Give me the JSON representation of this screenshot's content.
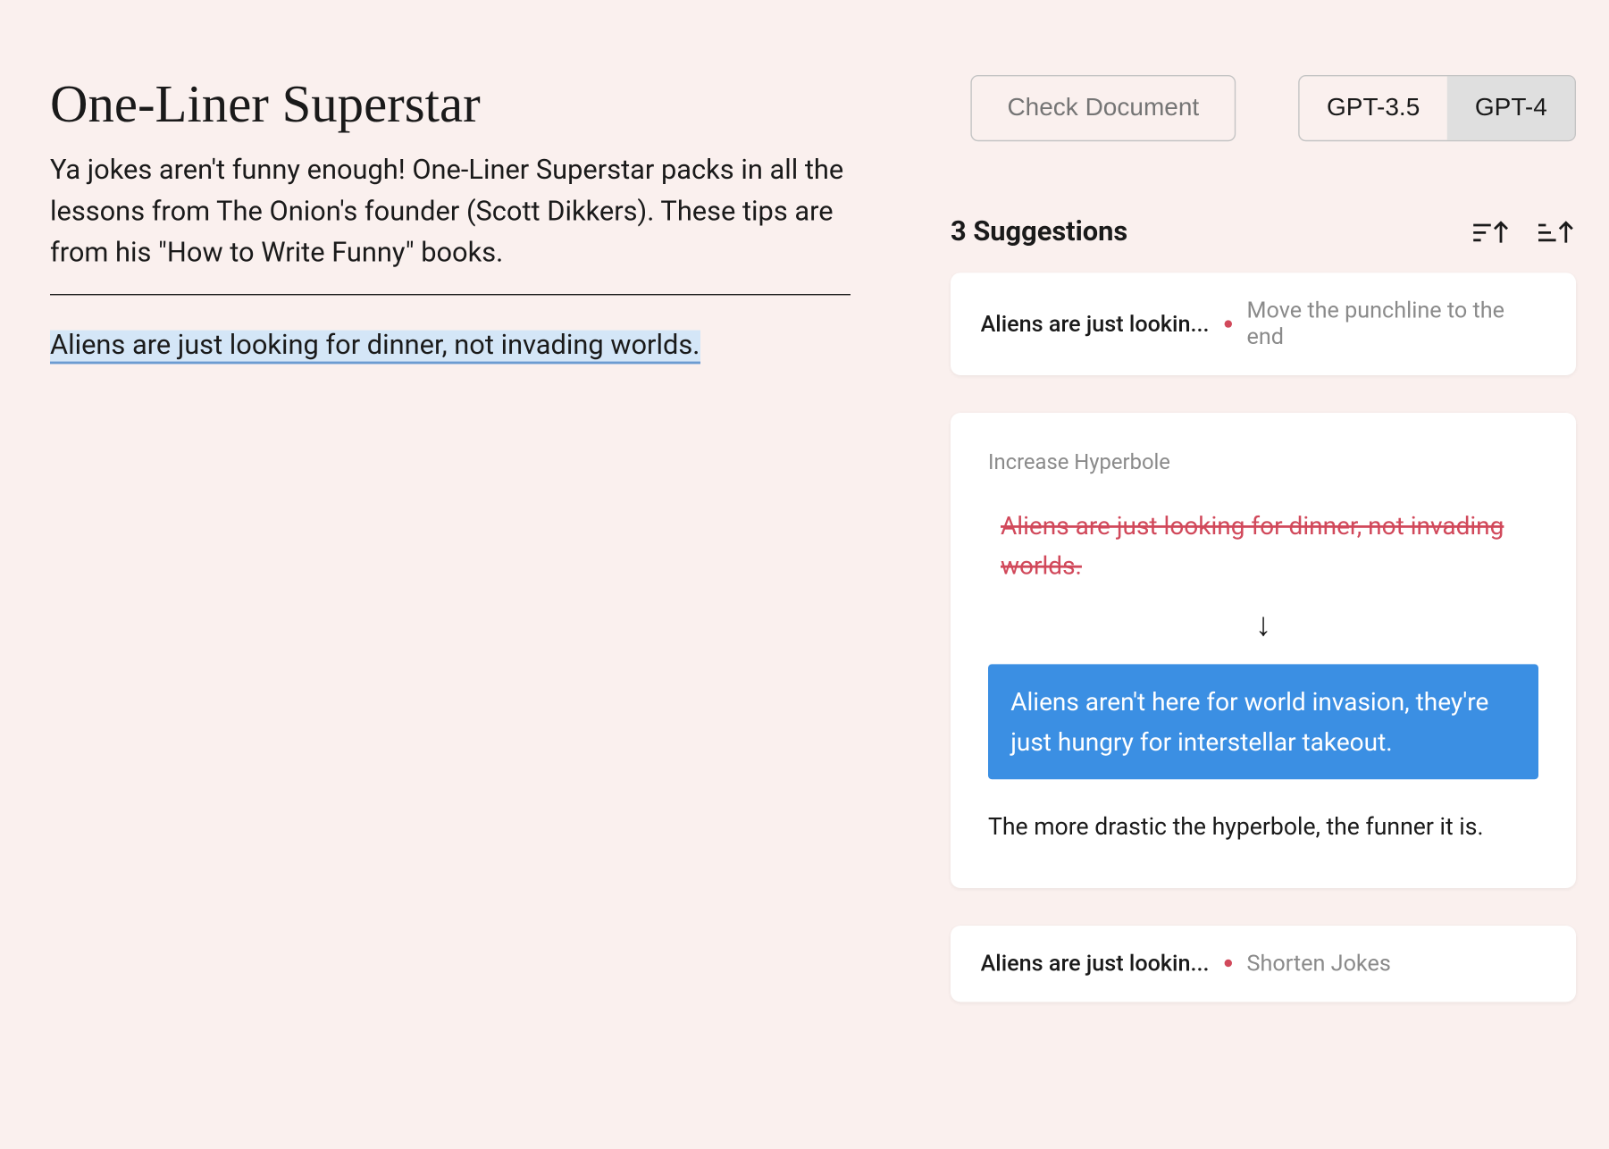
{
  "title": "One-Liner Superstar",
  "description": "Ya jokes aren't funny enough! One-Liner Superstar packs in all the lessons from The Onion's founder (Scott Dikkers). These tips are from his \"How to Write Funny\" books.",
  "work_text": "Aliens are just looking for dinner, not invading worlds.",
  "controls": {
    "check_document_label": "Check Document",
    "model_options": {
      "gpt35": "GPT-3.5",
      "gpt4": "GPT-4"
    },
    "active_model": "gpt4"
  },
  "suggestions": {
    "count_label": "3 Suggestions",
    "items": [
      {
        "preview": "Aliens are just lookin...",
        "label": "Move the punchline to the end"
      },
      {
        "expanded_label": "Increase Hyperbole",
        "original": "Aliens are just looking for dinner, not invading worlds.",
        "rewritten": "Aliens aren't here for world invasion, they're just hungry for interstellar takeout.",
        "explanation": "The more drastic the hyperbole, the funner it is."
      },
      {
        "preview": "Aliens are just lookin...",
        "label": "Shorten Jokes"
      }
    ]
  },
  "arrow_down_glyph": "↓"
}
